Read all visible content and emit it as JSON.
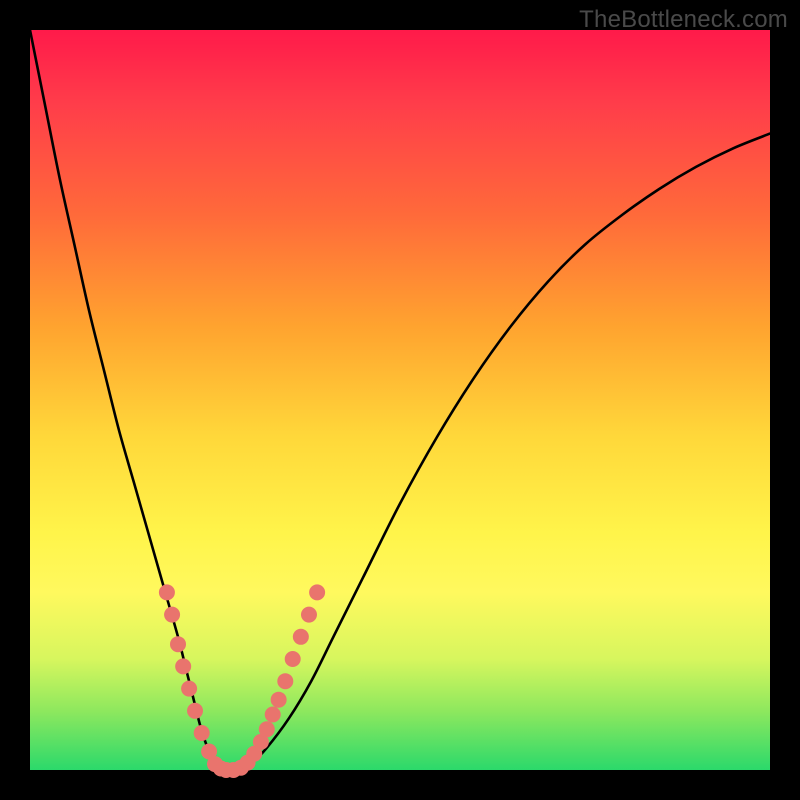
{
  "watermark": "TheBottleneck.com",
  "colors": {
    "gradient_top": "#ff1a4a",
    "gradient_bottom": "#2bd96b",
    "curve": "#000000",
    "dots": "#e9746d",
    "frame": "#000000"
  },
  "chart_data": {
    "type": "line",
    "title": "",
    "xlabel": "",
    "ylabel": "",
    "xlim": [
      0,
      100
    ],
    "ylim": [
      0,
      100
    ],
    "grid": false,
    "legend": false,
    "series": [
      {
        "name": "bottleneck-curve",
        "x": [
          0,
          2,
          4,
          6,
          8,
          10,
          12,
          14,
          16,
          18,
          20,
          21,
          22,
          23,
          24,
          25,
          26,
          28,
          30,
          32,
          35,
          38,
          41,
          45,
          50,
          55,
          60,
          65,
          70,
          75,
          80,
          85,
          90,
          95,
          100
        ],
        "y": [
          100,
          90,
          80,
          71,
          62,
          54,
          46,
          39,
          32,
          25,
          18,
          14,
          10,
          6,
          3,
          1,
          0,
          0,
          1,
          3,
          7,
          12,
          18,
          26,
          36,
          45,
          53,
          60,
          66,
          71,
          75,
          78.5,
          81.5,
          84,
          86
        ]
      }
    ],
    "markers": [
      {
        "x": 18.5,
        "y": 24
      },
      {
        "x": 19.2,
        "y": 21
      },
      {
        "x": 20.0,
        "y": 17
      },
      {
        "x": 20.7,
        "y": 14
      },
      {
        "x": 21.5,
        "y": 11
      },
      {
        "x": 22.3,
        "y": 8
      },
      {
        "x": 23.2,
        "y": 5
      },
      {
        "x": 24.2,
        "y": 2.5
      },
      {
        "x": 25.0,
        "y": 0.8
      },
      {
        "x": 25.8,
        "y": 0.2
      },
      {
        "x": 26.5,
        "y": 0
      },
      {
        "x": 27.5,
        "y": 0
      },
      {
        "x": 28.5,
        "y": 0.3
      },
      {
        "x": 29.4,
        "y": 1
      },
      {
        "x": 30.3,
        "y": 2.2
      },
      {
        "x": 31.2,
        "y": 3.8
      },
      {
        "x": 32.0,
        "y": 5.5
      },
      {
        "x": 32.8,
        "y": 7.5
      },
      {
        "x": 33.6,
        "y": 9.5
      },
      {
        "x": 34.5,
        "y": 12
      },
      {
        "x": 35.5,
        "y": 15
      },
      {
        "x": 36.6,
        "y": 18
      },
      {
        "x": 37.7,
        "y": 21
      },
      {
        "x": 38.8,
        "y": 24
      }
    ]
  }
}
